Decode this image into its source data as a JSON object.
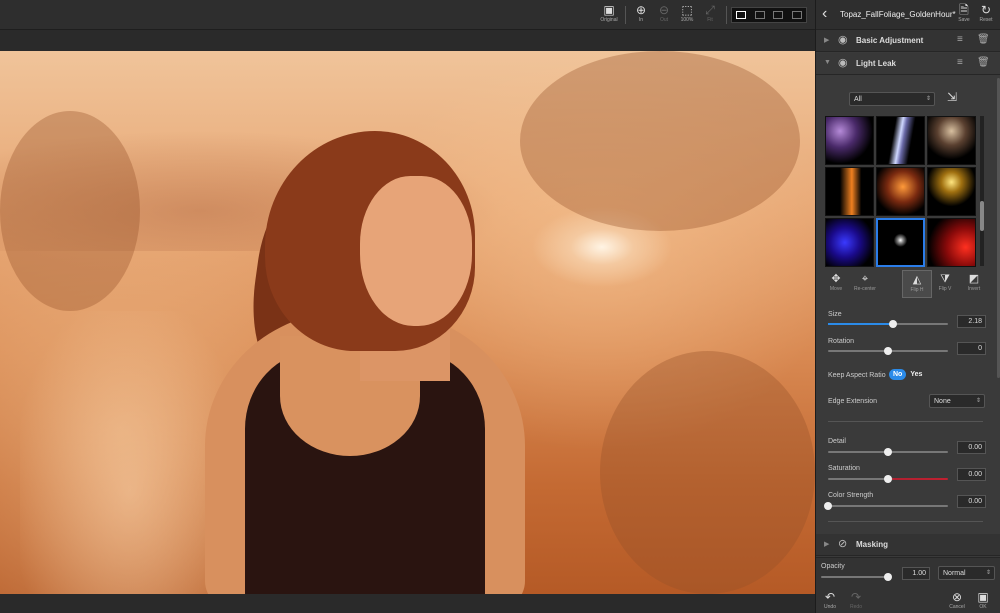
{
  "toolbar": {
    "original": "Original",
    "zoom_in": "In",
    "zoom_out": "Out",
    "zoom_100": "100%",
    "fit": "Fit"
  },
  "panel": {
    "file_title": "Topaz_FallFoliage_GoldenHour*",
    "save_label": "Save",
    "reset_label": "Reset",
    "sections": {
      "basic": "Basic Adjustment",
      "lightleak": "Light Leak",
      "masking": "Masking"
    },
    "filter": {
      "value": "All"
    },
    "tools": {
      "move": "Move",
      "recenter": "Re-center",
      "fliph": "Flip H",
      "flipv": "Flip V",
      "invert": "Invert"
    },
    "size": {
      "label": "Size",
      "value": "2.18",
      "level": 0.54
    },
    "rotation": {
      "label": "Rotation",
      "value": "0",
      "level": 0.5
    },
    "aspect": {
      "label": "Keep Aspect Ratio",
      "no": "No",
      "yes": "Yes"
    },
    "edge": {
      "label": "Edge Extension",
      "value": "None"
    },
    "detail": {
      "label": "Detail",
      "value": "0.00",
      "level": 0.5
    },
    "saturation": {
      "label": "Saturation",
      "value": "0.00",
      "level": 0.5
    },
    "color_strength": {
      "label": "Color Strength",
      "value": "0.00",
      "level": 0.0
    },
    "opacity": {
      "label": "Opacity",
      "value": "1.00",
      "level": 1.0
    },
    "blend": {
      "value": "Normal"
    },
    "undo": "Undo",
    "redo": "Redo",
    "cancel": "Cancel",
    "ok": "OK"
  },
  "colors": {
    "accent": "#2b8be9",
    "selected_thumb": "#2b7de9"
  }
}
